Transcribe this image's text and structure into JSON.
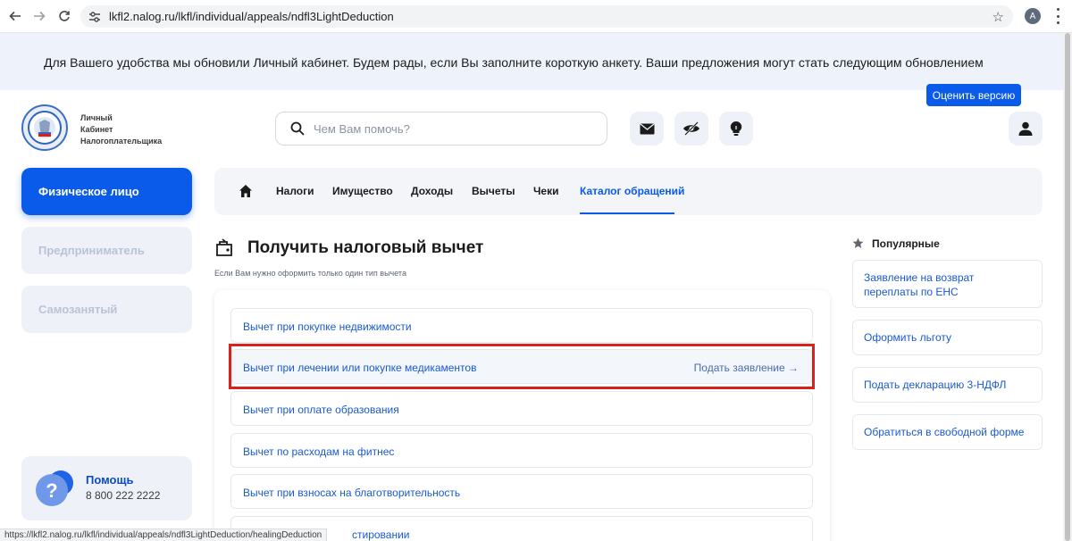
{
  "browser": {
    "url": "lkfl2.nalog.ru/lkfl/individual/appeals/ndfl3LightDeduction",
    "profile_initial": "A",
    "status_url": "https://lkfl2.nalog.ru/lkfl/individual/appeals/ndfl3LightDeduction/healingDeduction"
  },
  "banner": {
    "text": "Для Вашего удобства мы обновили Личный кабинет. Будем рады, если Вы заполните короткую анкету. Ваши предложения могут стать следующим обновлением",
    "button": "Оценить версию"
  },
  "header": {
    "logo_line1": "Личный",
    "logo_line2": "Кабинет",
    "logo_line3": "Налогоплательщика",
    "search_placeholder": "Чем Вам помочь?",
    "icons": [
      "mail-icon",
      "eye-off-icon",
      "lightbulb-icon",
      "user-icon"
    ]
  },
  "sidebar": {
    "items": [
      {
        "label": "Физическое лицо",
        "active": true
      },
      {
        "label": "Предприниматель",
        "active": false
      },
      {
        "label": "Самозанятый",
        "active": false
      }
    ],
    "help": {
      "title": "Помощь",
      "phone": "8 800 222 2222"
    }
  },
  "topnav": {
    "items": [
      "Налоги",
      "Имущество",
      "Доходы",
      "Вычеты",
      "Чеки",
      "Каталог обращений"
    ],
    "active_index": 5
  },
  "main": {
    "title": "Получить налоговый вычет",
    "subtitle": "Если Вам нужно оформить только один тип вычета",
    "rows": [
      "Вычет при покупке недвижимости",
      "Вычет при лечении или покупке медикаментов",
      "Вычет при оплате образования",
      "Вычет по расходам на фитнес",
      "Вычет при взносах на благотворительность",
      "стировании"
    ],
    "hover_action": "Подать заявление →"
  },
  "popular": {
    "title": "Популярные",
    "items": [
      "Заявление на возврат переплаты по ЕНС",
      "Оформить льготу",
      "Подать декларацию 3-НДФЛ",
      "Обратиться в свободной форме"
    ]
  },
  "colors": {
    "accent": "#0a5bea",
    "highlight_border": "#d9211c",
    "banner_bg": "#eef3fb"
  }
}
